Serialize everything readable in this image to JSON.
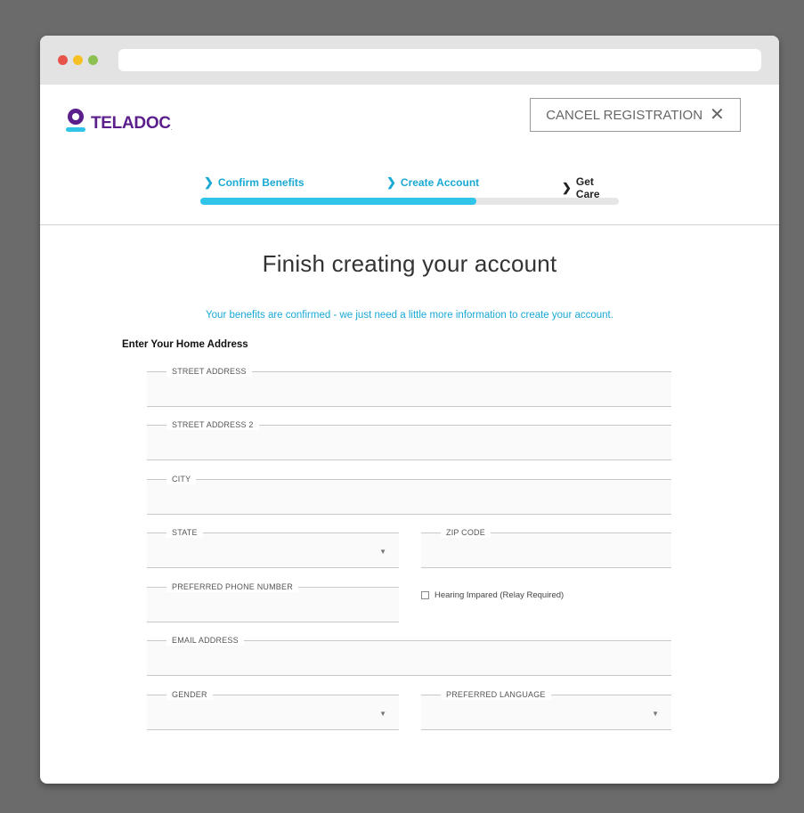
{
  "browser": {
    "traffic_lights": {
      "red": "#e5534b",
      "yellow": "#f5c024",
      "green": "#8cc152"
    }
  },
  "brand": {
    "name": "TELADOC",
    "tm": ".",
    "primary_color": "#5b1f8c",
    "accent_color": "#2fc4e8"
  },
  "header": {
    "cancel_label": "CANCEL REGISTRATION",
    "cancel_icon": "close-icon"
  },
  "steps": [
    {
      "label": "Confirm Benefits",
      "state": "complete"
    },
    {
      "label": "Create Account",
      "state": "current"
    },
    {
      "label": "Get Care",
      "state": "upcoming"
    }
  ],
  "progress": {
    "value": 0.66
  },
  "page": {
    "title": "Finish creating your account",
    "subtitle": "Your benefits are confirmed - we just need a little more information to create your account.",
    "section_label": "Enter Your Home Address"
  },
  "form": {
    "street_address": {
      "label": "STREET ADDRESS",
      "value": ""
    },
    "street_address_2": {
      "label": "STREET ADDRESS 2",
      "value": ""
    },
    "city": {
      "label": "CITY",
      "value": ""
    },
    "state": {
      "label": "STATE",
      "value": ""
    },
    "zip_code": {
      "label": "ZIP CODE",
      "value": ""
    },
    "phone": {
      "label": "PREFERRED PHONE NUMBER",
      "value": ""
    },
    "hearing_impaired": {
      "label": "Hearing Impared (Relay Required)",
      "checked": false
    },
    "email": {
      "label": "EMAIL ADDRESS",
      "value": ""
    },
    "gender": {
      "label": "GENDER",
      "value": ""
    },
    "language": {
      "label": "PREFERRED LANGUAGE",
      "value": ""
    }
  }
}
